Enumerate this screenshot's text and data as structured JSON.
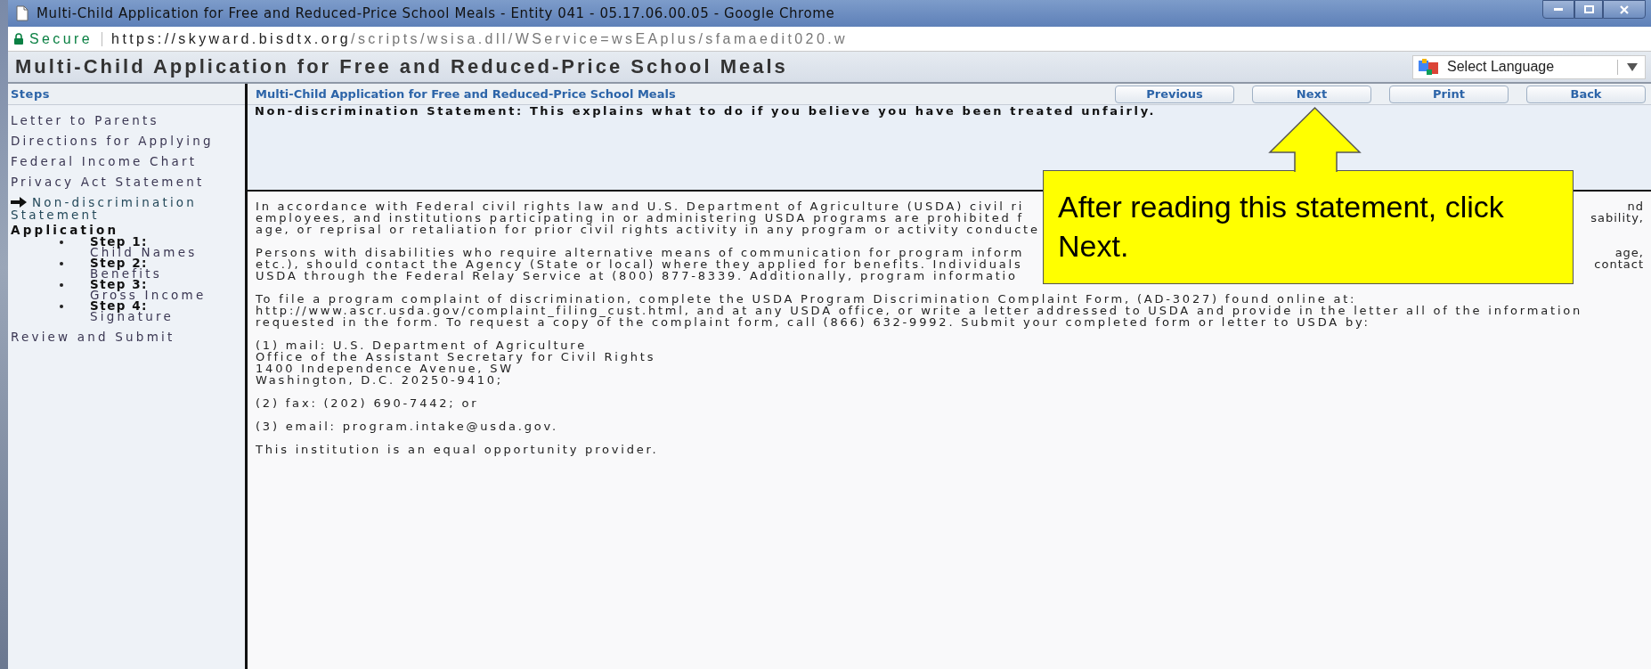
{
  "window": {
    "title": "Multi-Child Application for Free and Reduced-Price School Meals - Entity 041 - 05.17.06.00.05 - Google Chrome"
  },
  "address_bar": {
    "secure_label": "Secure",
    "url_host": "https://skyward.bisdtx.org",
    "url_path": "/scripts/wsisa.dll/WService=wsEAplus/sfamaedit020.w"
  },
  "app_header": {
    "title": "Multi-Child Application for Free and Reduced-Price School Meals",
    "language_select": "Select Language"
  },
  "sidebar": {
    "title": "Steps",
    "items": [
      {
        "kind": "link",
        "label": "Letter to Parents",
        "selected": false
      },
      {
        "kind": "link",
        "label": "Directions for Applying",
        "selected": false
      },
      {
        "kind": "link",
        "label": "Federal Income Chart",
        "selected": false
      },
      {
        "kind": "link",
        "label": "Privacy Act Statement",
        "selected": false
      },
      {
        "kind": "link",
        "label": "Non-discrimination Statement",
        "selected": true
      },
      {
        "kind": "heading",
        "label": "Application",
        "selected": false
      },
      {
        "kind": "step",
        "label": "Step 1:",
        "detail": "Child Names",
        "selected": false
      },
      {
        "kind": "step",
        "label": "Step 2:",
        "detail": "Benefits",
        "selected": false
      },
      {
        "kind": "step",
        "label": "Step 3:",
        "detail": "Gross Income",
        "selected": false
      },
      {
        "kind": "step",
        "label": "Step 4:",
        "detail": "Signature",
        "selected": false
      },
      {
        "kind": "link",
        "label": "Review and Submit",
        "selected": false
      }
    ]
  },
  "content": {
    "title": "Multi-Child Application for Free and Reduced-Price School Meals",
    "buttons": [
      "Previous",
      "Next",
      "Print",
      "Back"
    ],
    "statement": "Non-discrimination Statement: This explains what to do if you believe you have been treated unfairly.",
    "paragraphs": [
      {
        "lines": [
          {
            "left": "In accordance with Federal civil rights law and U.S. Department of Agriculture (USDA) civil ri",
            "right": "nd"
          },
          {
            "left": "employees, and institutions participating in or administering USDA programs are prohibited f",
            "right": "sability,"
          },
          {
            "left": "age, or reprisal or retaliation for prior civil rights activity in any program or activity conducte"
          }
        ]
      },
      {
        "lines": [
          {
            "left": "Persons with disabilities who require alternative means of communication for program inform",
            "right": "age,"
          },
          {
            "left": "etc.), should contact the Agency (State or local) where they applied for benefits. Individuals",
            "right": "contact"
          },
          {
            "left": "USDA through the Federal Relay Service at (800) 877-8339. Additionally, program informatio"
          }
        ]
      },
      {
        "lines": [
          {
            "left": "To file a program complaint of discrimination, complete the USDA Program Discrimination Complaint Form, (AD-3027) found online at:"
          },
          {
            "left": "http://www.ascr.usda.gov/complaint_filing_cust.html, and at any USDA office, or write a letter addressed to USDA and provide in the letter all of the information"
          },
          {
            "left": "requested in the form. To request a copy of the complaint form, call (866) 632-9992. Submit your completed form or letter to USDA by:"
          }
        ]
      },
      {
        "lines": [
          {
            "left": "(1) mail: U.S. Department of Agriculture"
          },
          {
            "left": "Office of the Assistant Secretary for Civil Rights"
          },
          {
            "left": "1400 Independence Avenue, SW"
          },
          {
            "left": "Washington, D.C. 20250-9410;"
          }
        ]
      },
      {
        "lines": [
          {
            "left": "(2) fax: (202) 690-7442; or"
          }
        ]
      },
      {
        "lines": [
          {
            "left": "(3) email: program.intake@usda.gov."
          }
        ]
      },
      {
        "lines": [
          {
            "left": "This institution is an equal opportunity provider."
          }
        ]
      }
    ]
  },
  "callout": {
    "text": "After reading this statement, click Next."
  }
}
